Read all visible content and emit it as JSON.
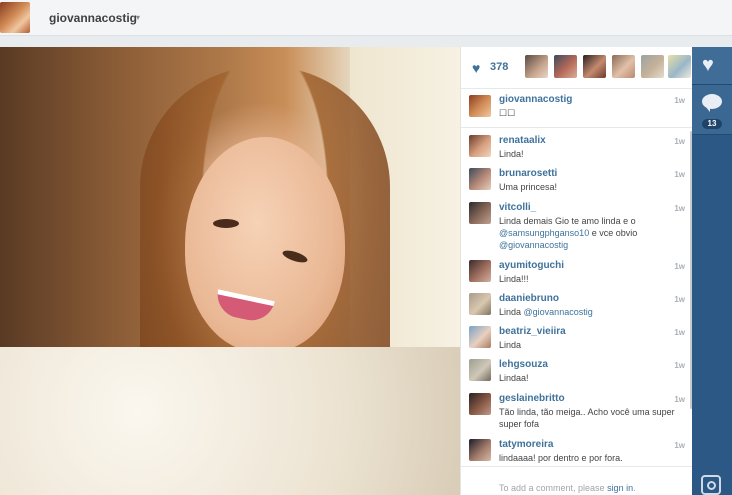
{
  "header": {
    "username": "giovannacostig",
    "caret": "▾"
  },
  "likes": {
    "count": "378",
    "heart": "♥"
  },
  "actions": {
    "like_icon": "♥",
    "comment_count": "13"
  },
  "caption": {
    "user": "giovannacostig",
    "text": "☐☐",
    "time": "1w"
  },
  "comments": [
    {
      "user": "renataalix",
      "time": "1w",
      "text": "Linda!"
    },
    {
      "user": "brunarosetti",
      "time": "1w",
      "text": "Uma princesa!"
    },
    {
      "user": "vitcolli_",
      "time": "1w",
      "text_before": "Linda demais Gio te amo linda e o ",
      "mention1": "@samsungphganso10",
      "text_middle": " e vce obvio ",
      "mention2": "@giovannacostig"
    },
    {
      "user": "ayumitoguchi",
      "time": "1w",
      "text": "Linda!!!"
    },
    {
      "user": "daaniebruno",
      "time": "1w",
      "text_before": "Linda ",
      "mention1": "@giovannacostig"
    },
    {
      "user": "beatriz_vieiira",
      "time": "1w",
      "text": "Linda"
    },
    {
      "user": "lehgsouza",
      "time": "1w",
      "text": "Lindaa!"
    },
    {
      "user": "geslainebritto",
      "time": "1w",
      "text": "Tão linda, tão meiga.. Acho você uma super super fofa"
    },
    {
      "user": "tatymoreira",
      "time": "1w",
      "text": "lindaaaa! por dentro e por fora."
    }
  ],
  "add_comment": {
    "prompt": "To add a comment, please ",
    "link": "sign in",
    "end": "."
  }
}
